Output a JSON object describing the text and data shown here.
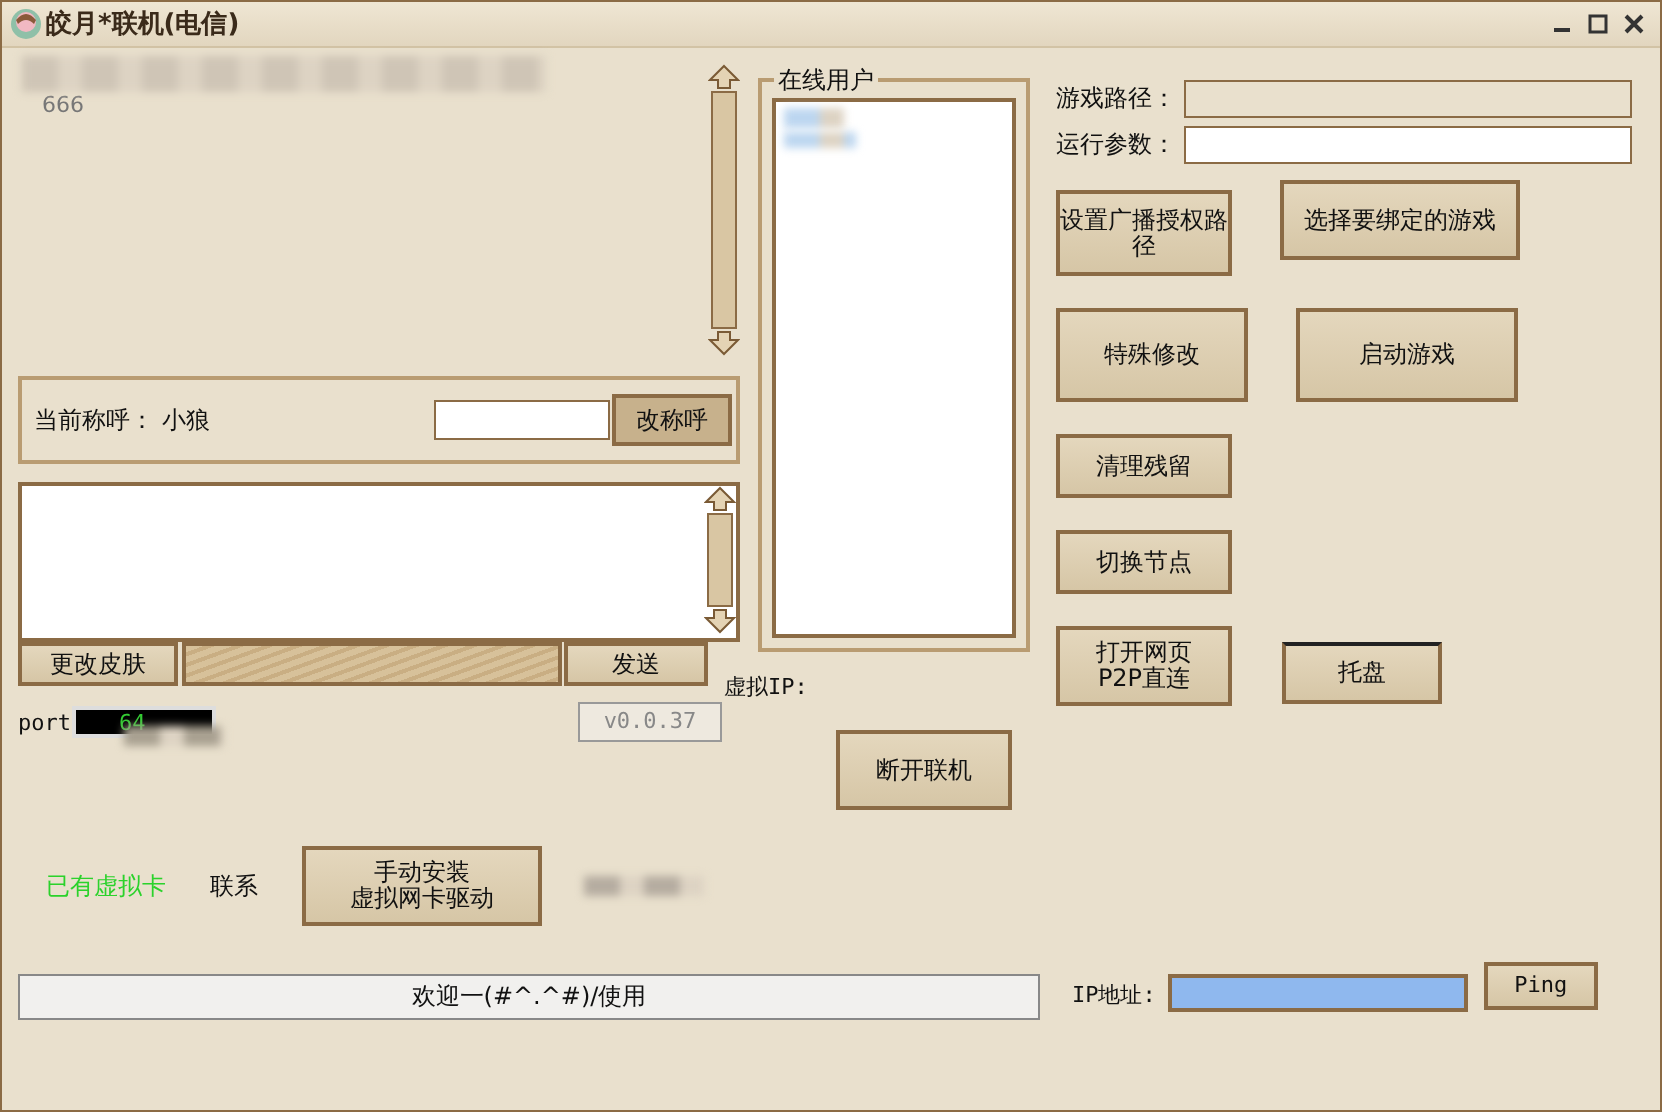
{
  "window": {
    "title": "皎月*联机(电信)"
  },
  "chat": {
    "messages": [
      "666"
    ]
  },
  "nickname": {
    "label": "当前称呼：",
    "value": "小狼",
    "button": "改称呼"
  },
  "message_bar": {
    "skin_button": "更改皮肤",
    "send_button": "发送"
  },
  "port": {
    "label": "port",
    "value": "64"
  },
  "version": "v0.0.37",
  "virtual_card": {
    "status": "已有虚拟卡",
    "contact": "联系",
    "install_button": [
      "手动安装",
      "虚拟网卡驱动"
    ]
  },
  "online_users": {
    "title": "在线用户"
  },
  "virtual_ip": {
    "label": "虚拟IP:"
  },
  "disconnect_button": "断开联机",
  "game": {
    "path_label": "游戏路径：",
    "path_disabled": true,
    "args_label": "运行参数："
  },
  "actions": [
    [
      [
        "设置广播授权路径"
      ],
      [
        "选择要绑定的游戏"
      ]
    ],
    [
      [
        "特殊修改"
      ],
      [
        "启动游戏"
      ]
    ],
    [
      [
        "清理残留"
      ]
    ],
    [
      [
        "切换节点"
      ]
    ],
    [
      [
        "打开网页",
        "P2P直连"
      ],
      [
        "托盘"
      ]
    ]
  ],
  "status_bar": {
    "text": "欢迎一(#^.^#)/使用"
  },
  "ip": {
    "label": "IP地址:",
    "ping_button": "Ping"
  }
}
